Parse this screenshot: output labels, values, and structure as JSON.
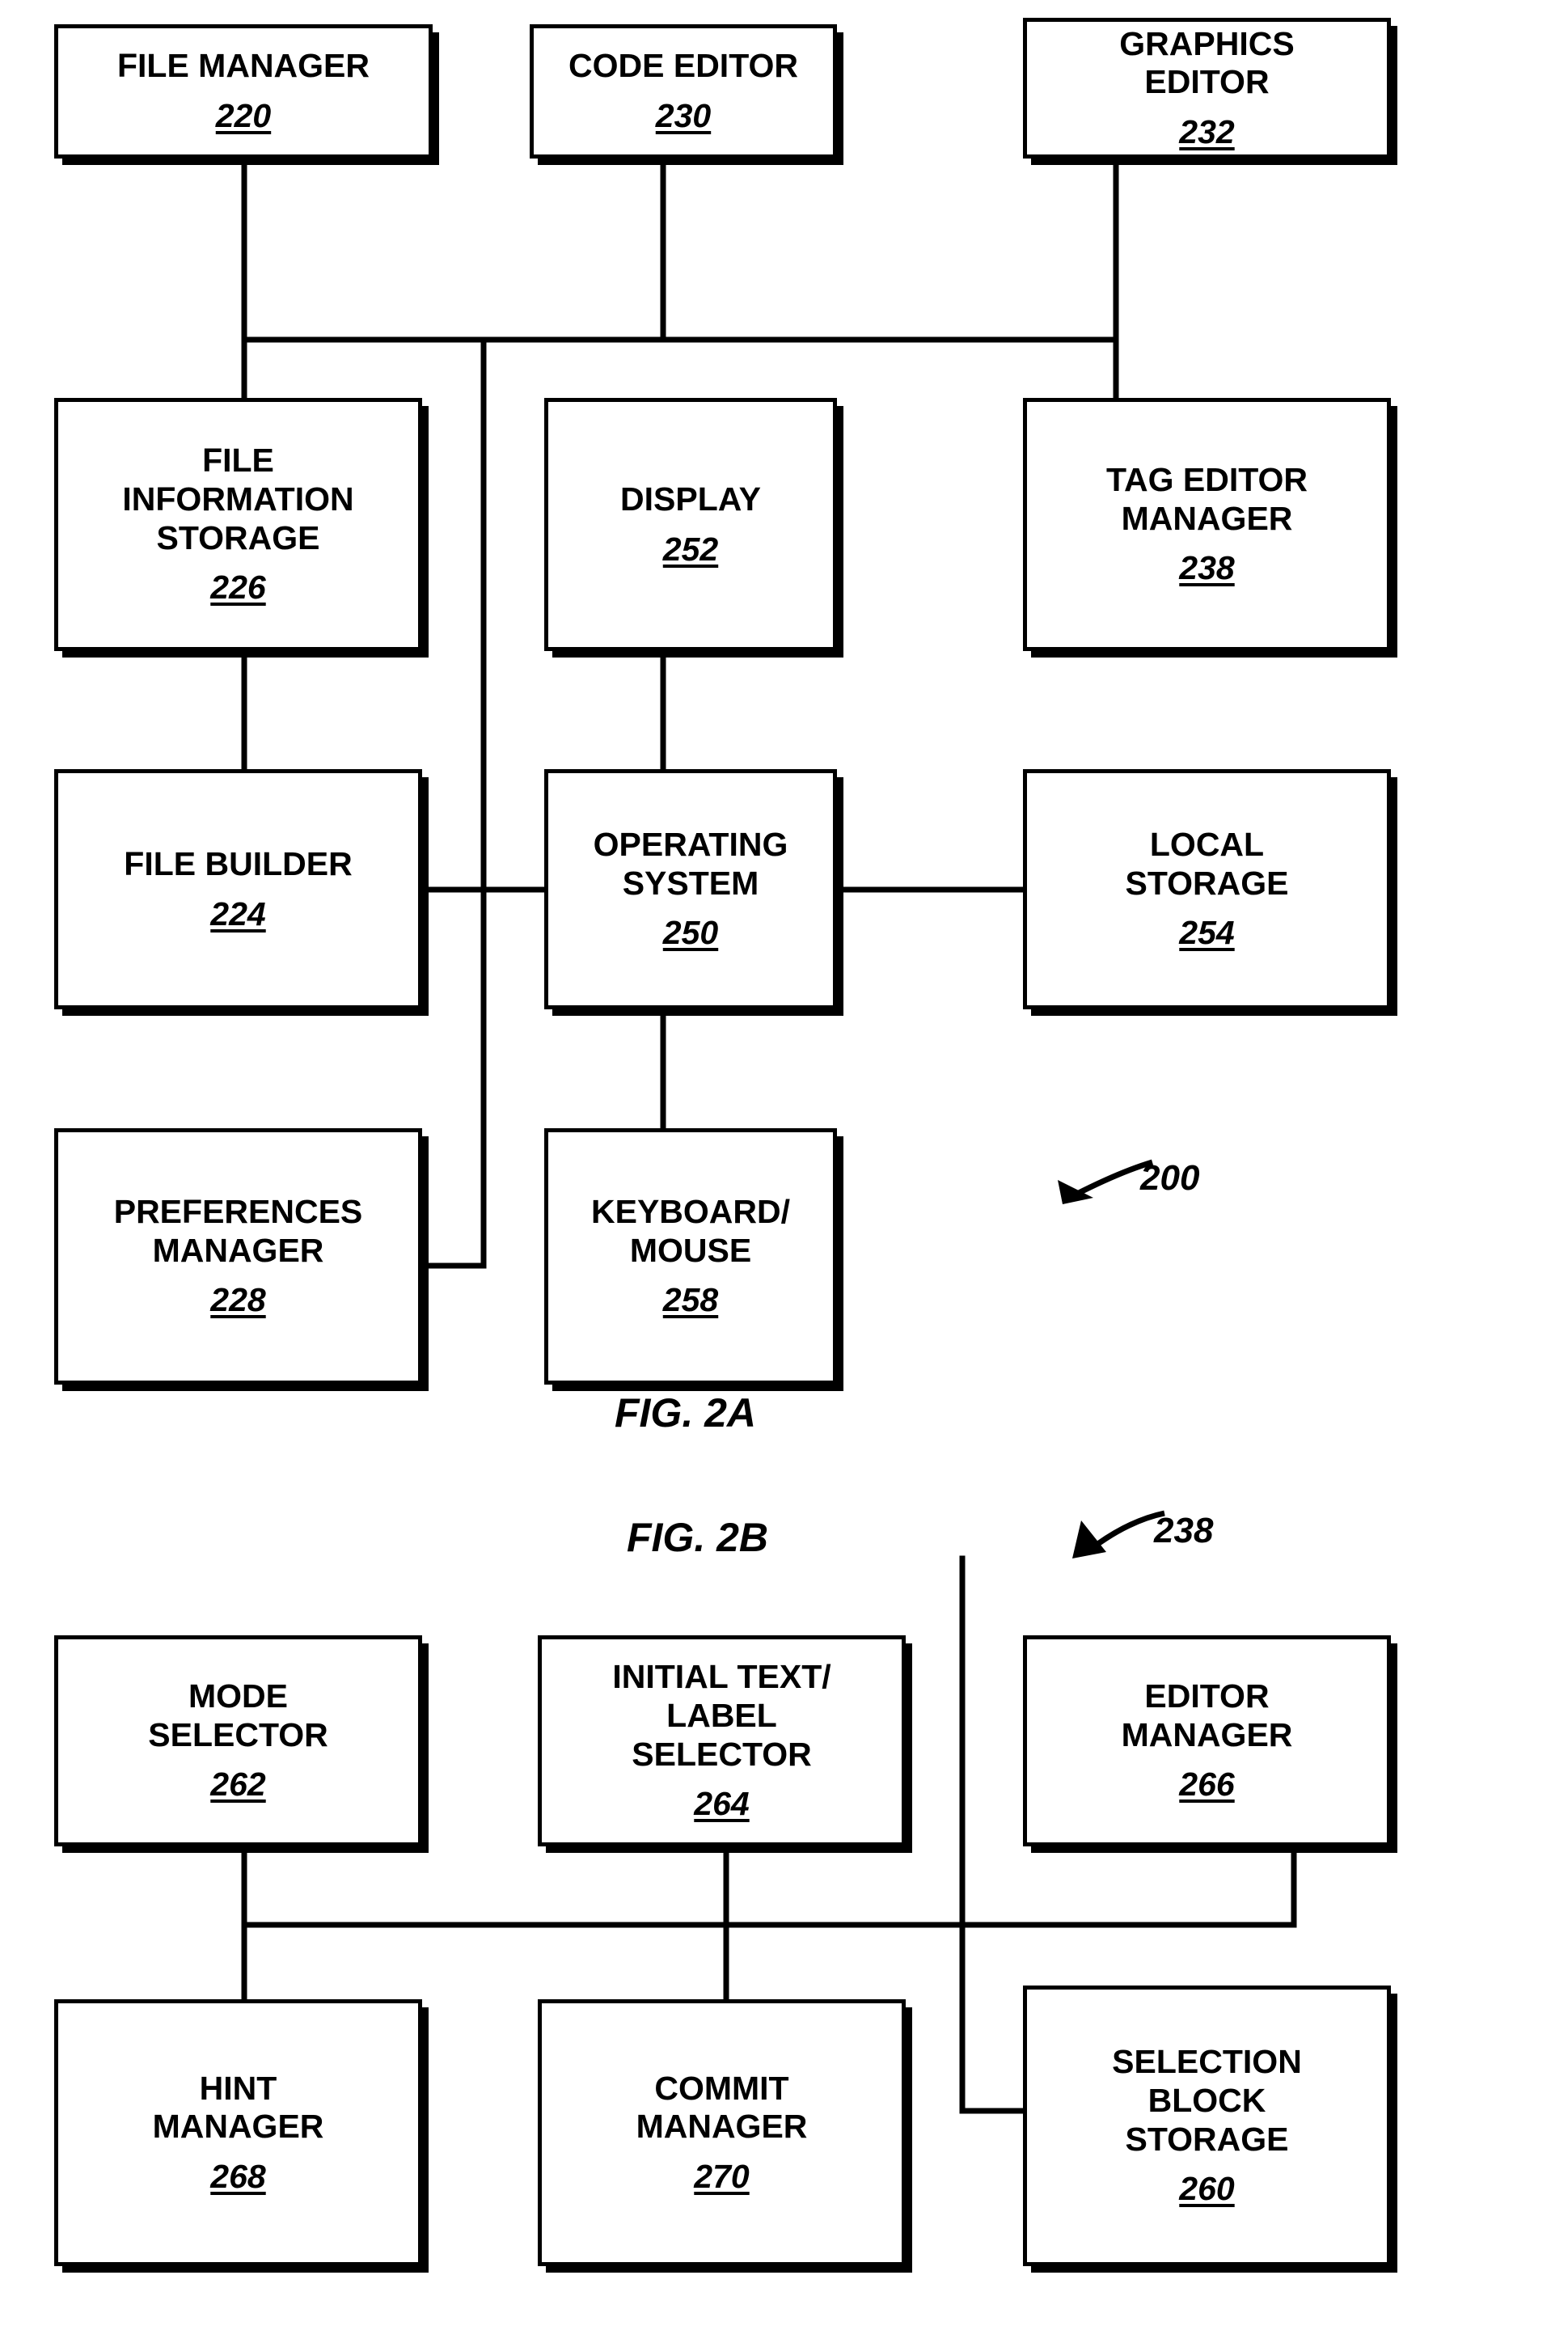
{
  "figures": [
    {
      "id": "fig2a",
      "caption": "FIG. 2A",
      "reference": "200",
      "boxes": [
        {
          "key": "file_manager",
          "lines": [
            "FILE MANAGER"
          ],
          "number": "220"
        },
        {
          "key": "code_editor",
          "lines": [
            "CODE EDITOR"
          ],
          "number": "230"
        },
        {
          "key": "graphics_editor",
          "lines": [
            "GRAPHICS",
            "EDITOR"
          ],
          "number": "232"
        },
        {
          "key": "file_info_storage",
          "lines": [
            "FILE",
            "INFORMATION",
            "STORAGE"
          ],
          "number": "226"
        },
        {
          "key": "display",
          "lines": [
            "DISPLAY"
          ],
          "number": "252"
        },
        {
          "key": "tag_editor_manager",
          "lines": [
            "TAG EDITOR",
            "MANAGER"
          ],
          "number": "238"
        },
        {
          "key": "file_builder",
          "lines": [
            "FILE BUILDER"
          ],
          "number": "224"
        },
        {
          "key": "operating_system",
          "lines": [
            "OPERATING",
            "SYSTEM"
          ],
          "number": "250"
        },
        {
          "key": "local_storage",
          "lines": [
            "LOCAL",
            "STORAGE"
          ],
          "number": "254"
        },
        {
          "key": "preferences_manager",
          "lines": [
            "PREFERENCES",
            "MANAGER"
          ],
          "number": "228"
        },
        {
          "key": "keyboard_mouse",
          "lines": [
            "KEYBOARD/",
            "MOUSE"
          ],
          "number": "258"
        }
      ]
    },
    {
      "id": "fig2b",
      "caption": "FIG. 2B",
      "reference": "238",
      "boxes": [
        {
          "key": "mode_selector",
          "lines": [
            "MODE",
            "SELECTOR"
          ],
          "number": "262"
        },
        {
          "key": "initial_text_label_selector",
          "lines": [
            "INITIAL TEXT/",
            "LABEL",
            "SELECTOR"
          ],
          "number": "264"
        },
        {
          "key": "editor_manager",
          "lines": [
            "EDITOR",
            "MANAGER"
          ],
          "number": "266"
        },
        {
          "key": "hint_manager",
          "lines": [
            "HINT",
            "MANAGER"
          ],
          "number": "268"
        },
        {
          "key": "commit_manager",
          "lines": [
            "COMMIT",
            "MANAGER"
          ],
          "number": "270"
        },
        {
          "key": "selection_block_storage",
          "lines": [
            "SELECTION",
            "BLOCK",
            "STORAGE"
          ],
          "number": "260"
        }
      ]
    }
  ],
  "colors": {
    "ink": "#000000",
    "paper": "#ffffff"
  }
}
